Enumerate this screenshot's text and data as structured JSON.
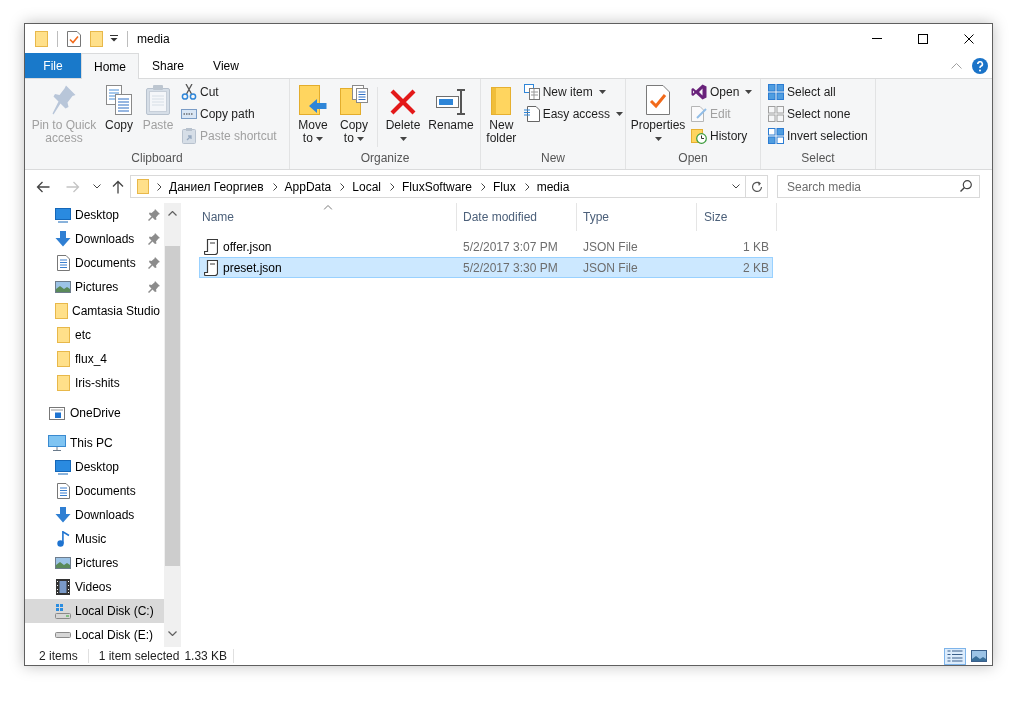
{
  "window": {
    "title": "media"
  },
  "ribbon_tabs": [
    {
      "label": "File",
      "kind": "menu",
      "selected": false
    },
    {
      "label": "Home",
      "kind": "tab",
      "selected": true
    },
    {
      "label": "Share",
      "kind": "tab",
      "selected": false
    },
    {
      "label": "View",
      "kind": "tab",
      "selected": false
    }
  ],
  "ribbon_groups": [
    {
      "label": "Clipboard",
      "commands": [
        {
          "label": "Pin to Quick access",
          "kind": "large",
          "disabled": true,
          "menu": false
        },
        {
          "label": "Copy",
          "kind": "large",
          "disabled": false,
          "menu": false
        },
        {
          "label": "Paste",
          "kind": "large",
          "disabled": true,
          "menu": false
        },
        {
          "label": "Cut",
          "kind": "small",
          "disabled": false,
          "menu": false
        },
        {
          "label": "Copy path",
          "kind": "small",
          "disabled": false,
          "menu": false
        },
        {
          "label": "Paste shortcut",
          "kind": "small",
          "disabled": true,
          "menu": false
        }
      ]
    },
    {
      "label": "Organize",
      "commands": [
        {
          "label": "Move to",
          "kind": "large",
          "disabled": false,
          "menu": true
        },
        {
          "label": "Copy to",
          "kind": "large",
          "disabled": false,
          "menu": true
        },
        {
          "label": "Delete",
          "kind": "large",
          "disabled": false,
          "menu": true
        },
        {
          "label": "Rename",
          "kind": "large",
          "disabled": false,
          "menu": false
        }
      ]
    },
    {
      "label": "New",
      "commands": [
        {
          "label": "New folder",
          "kind": "large",
          "disabled": false,
          "menu": false
        },
        {
          "label": "New item",
          "kind": "small",
          "disabled": false,
          "menu": true
        },
        {
          "label": "Easy access",
          "kind": "small",
          "disabled": false,
          "menu": true
        }
      ]
    },
    {
      "label": "Open",
      "commands": [
        {
          "label": "Properties",
          "kind": "large",
          "disabled": false,
          "menu": true
        },
        {
          "label": "Open",
          "kind": "small",
          "disabled": false,
          "menu": true
        },
        {
          "label": "Edit",
          "kind": "small",
          "disabled": true,
          "menu": false
        },
        {
          "label": "History",
          "kind": "small",
          "disabled": false,
          "menu": false
        }
      ]
    },
    {
      "label": "Select",
      "commands": [
        {
          "label": "Select all",
          "kind": "small",
          "disabled": false,
          "menu": false
        },
        {
          "label": "Select none",
          "kind": "small",
          "disabled": false,
          "menu": false
        },
        {
          "label": "Invert selection",
          "kind": "small",
          "disabled": false,
          "menu": false
        }
      ]
    }
  ],
  "address_bar": {
    "nav_buttons": [
      {
        "kind": "back",
        "disabled": false
      },
      {
        "kind": "forward",
        "disabled": true
      },
      {
        "kind": "recent",
        "disabled": false
      },
      {
        "kind": "up",
        "disabled": false
      }
    ],
    "breadcrumbs": [
      "Даниел Георгиев",
      "AppData",
      "Local",
      "FluxSoftware",
      "Flux",
      "media"
    ]
  },
  "search": {
    "placeholder": "Search media"
  },
  "navigation_pane": {
    "quick_access": [
      {
        "label": "Desktop",
        "kind": "desktop",
        "pinned": true,
        "selected": false
      },
      {
        "label": "Downloads",
        "kind": "downloads",
        "pinned": true,
        "selected": false
      },
      {
        "label": "Documents",
        "kind": "documents",
        "pinned": true,
        "selected": false
      },
      {
        "label": "Pictures",
        "kind": "pictures",
        "pinned": true,
        "selected": false
      },
      {
        "label": "Camtasia Studio",
        "kind": "folder",
        "pinned": false,
        "selected": false
      },
      {
        "label": "etc",
        "kind": "folder",
        "pinned": false,
        "selected": false
      },
      {
        "label": "flux_4",
        "kind": "folder",
        "pinned": false,
        "selected": false
      },
      {
        "label": "Iris-shits",
        "kind": "folder",
        "pinned": false,
        "selected": false
      }
    ],
    "onedrive": {
      "label": "OneDrive",
      "selected": false
    },
    "this_pc": {
      "label": "This PC",
      "selected": false,
      "children": [
        {
          "label": "Desktop",
          "kind": "desktop",
          "selected": false
        },
        {
          "label": "Documents",
          "kind": "documents",
          "selected": false
        },
        {
          "label": "Downloads",
          "kind": "downloads",
          "selected": false
        },
        {
          "label": "Music",
          "kind": "music",
          "selected": false
        },
        {
          "label": "Pictures",
          "kind": "pictures",
          "selected": false
        },
        {
          "label": "Videos",
          "kind": "videos",
          "selected": false
        },
        {
          "label": "Local Disk (C:)",
          "kind": "system_drive",
          "selected": true
        },
        {
          "label": "Local Disk (E:)",
          "kind": "drive",
          "selected": false
        }
      ]
    }
  },
  "file_list": {
    "columns": [
      {
        "label": "Name",
        "sorted": true
      },
      {
        "label": "Date modified",
        "sorted": false
      },
      {
        "label": "Type",
        "sorted": false
      },
      {
        "label": "Size",
        "sorted": false
      }
    ],
    "rows": [
      {
        "name": "offer.json",
        "date_modified": "5/2/2017 3:07 PM",
        "type": "JSON File",
        "size": "1 KB",
        "selected": false
      },
      {
        "name": "preset.json",
        "date_modified": "5/2/2017 3:30 PM",
        "type": "JSON File",
        "size": "2 KB",
        "selected": true
      }
    ]
  },
  "status_bar": {
    "item_count": "2 items",
    "selection": "1 item selected",
    "selection_size": "1.33 KB",
    "views": [
      {
        "kind": "details",
        "selected": true
      },
      {
        "kind": "large_icons",
        "selected": false
      }
    ]
  }
}
